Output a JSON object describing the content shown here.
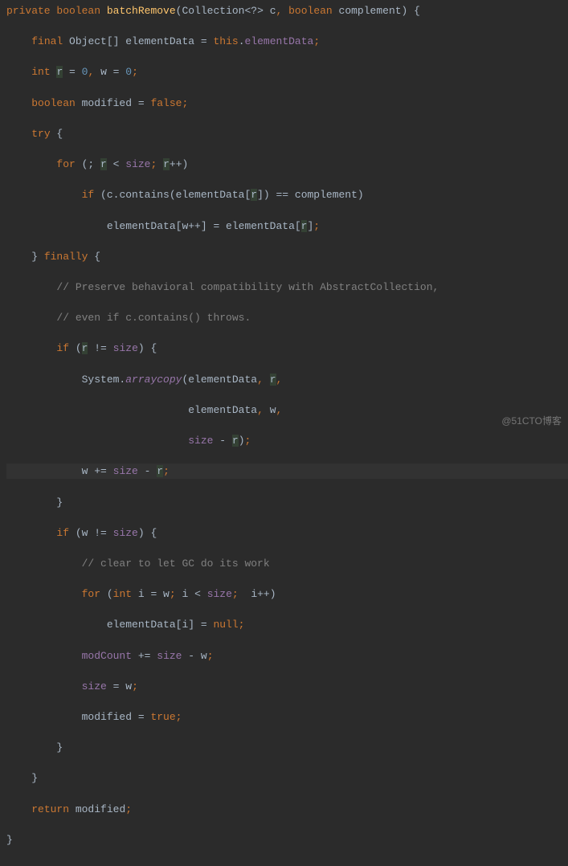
{
  "code": {
    "l1": {
      "kw1": "private",
      "kw2": "boolean",
      "method": "batchRemove",
      "sig": "(Collection<?> c",
      "kw3": "boolean",
      "param": "complement) {"
    },
    "l2": {
      "kw": "final",
      "txt1": "Object[] elementData = ",
      "kw2": "this",
      "txt2": ".",
      "field": "elementData",
      "sc": ";"
    },
    "l3": {
      "kw": "int",
      "v1": "r",
      "eq1": " = ",
      "n1": "0",
      "c": ", ",
      "v2": "w = ",
      "n2": "0",
      "sc": ";"
    },
    "l4": {
      "kw": "boolean",
      "txt": " modified = ",
      "kw2": "false",
      "sc": ";"
    },
    "l5": {
      "kw": "try",
      "br": " {"
    },
    "l6": {
      "kw": "for",
      "open": " (; ",
      "r1": "r",
      "mid": " < ",
      "size": "size",
      "sep": "; ",
      "r2": "r",
      "inc": "++)"
    },
    "l7": {
      "kw": "if",
      "open": " (c.contains(elementData[",
      "r": "r",
      "mid": "]) == complement)"
    },
    "l8": {
      "txt1": "elementData[w++] = elementData[",
      "r": "r",
      "txt2": "]",
      "sc": ";"
    },
    "l9": {
      "br": "} ",
      "kw": "finally",
      "open": " {"
    },
    "l10": {
      "cmt": "// Preserve behavioral compatibility with AbstractCollection,"
    },
    "l11": {
      "cmt": "// even if c.contains() throws."
    },
    "l12": {
      "kw": "if",
      "open": " (",
      "r": "r",
      "mid": " != ",
      "size": "size",
      "close": ") {"
    },
    "l13": {
      "txt": "System.",
      "method": "arraycopy",
      "open": "(elementData",
      "c": ", ",
      "r": "r",
      "c2": ","
    },
    "l14": {
      "txt": "elementData",
      "c": ", ",
      "v": "w",
      "c2": ","
    },
    "l15": {
      "size": "size",
      "mid": " - ",
      "r": "r",
      "close": ")",
      "sc": ";"
    },
    "l16": {
      "v": "w += ",
      "size": "size",
      "mid": " - ",
      "r": "r",
      "sc": ";"
    },
    "l17": {
      "br": "}"
    },
    "l18": {
      "kw": "if",
      "txt": " (w != ",
      "size": "size",
      "close": ") {"
    },
    "l19": {
      "cmt": "// clear to let GC do its work"
    },
    "l20": {
      "kw": "for",
      "open": " (",
      "kw2": "int",
      "txt": " i = w",
      "sc1": ";",
      "mid": " i < ",
      "size": "size",
      "sc2": ";",
      "inc": "  i++)"
    },
    "l21": {
      "txt": "elementData[i] = ",
      "kw": "null",
      "sc": ";"
    },
    "l22": {
      "field": "modCount",
      "txt": " += ",
      "size": "size",
      "mid": " - w",
      "sc": ";"
    },
    "l23": {
      "size": "size",
      "txt": " = w",
      "sc": ";"
    },
    "l24": {
      "txt": "modified = ",
      "kw": "true",
      "sc": ";"
    },
    "l25": {
      "br": "}"
    },
    "l26": {
      "br": "}"
    },
    "l27": {
      "kw": "return",
      "txt": " modified",
      "sc": ";"
    },
    "l28": {
      "br": "}"
    }
  },
  "watermark": "@51CTO博客"
}
